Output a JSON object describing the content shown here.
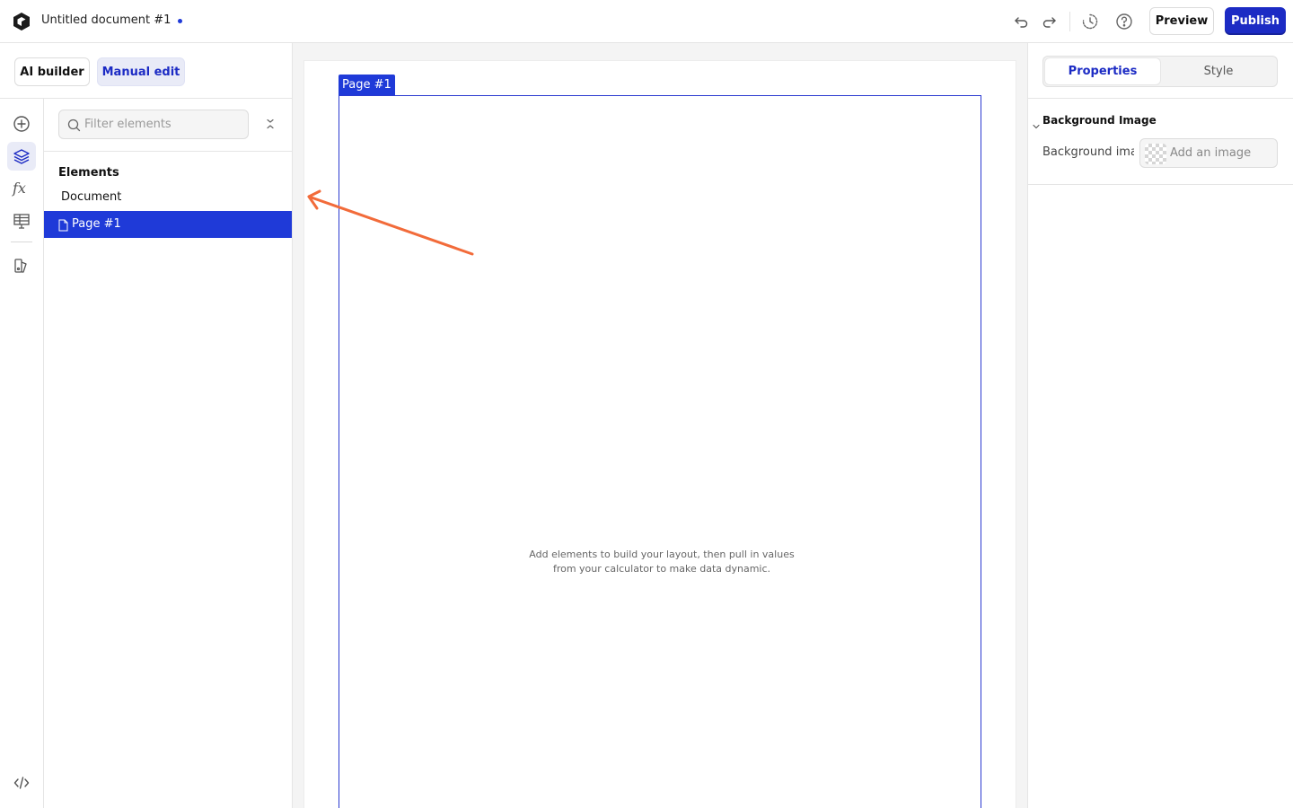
{
  "app": {
    "document_title": "Untitled document #1",
    "icons": {
      "logo": "app-logo-icon",
      "undo": "undo-icon",
      "redo": "redo-icon",
      "history": "history-icon",
      "help": "help-icon"
    }
  },
  "toolbar": {
    "preview_label": "Preview",
    "publish_label": "Publish",
    "publish_color": "#1c2bc4"
  },
  "left_panel": {
    "modes": {
      "ai_builder": "AI builder",
      "manual_edit": "Manual edit",
      "active": "manual_edit"
    },
    "rail": [
      {
        "name": "add-icon",
        "active": false
      },
      {
        "name": "layers-icon",
        "active": true
      },
      {
        "name": "formula-icon",
        "active": false
      },
      {
        "name": "table-icon",
        "active": false
      },
      {
        "name": "theme-icon",
        "active": false
      },
      {
        "name": "code-icon",
        "active": false
      }
    ],
    "filter": {
      "placeholder": "Filter elements",
      "value": ""
    },
    "tree": {
      "heading": "Elements",
      "items": [
        {
          "label": "Document",
          "selected": false
        },
        {
          "label": "Page #1",
          "selected": true
        }
      ]
    }
  },
  "canvas": {
    "page_tag": "Page #1",
    "empty_message": "Add elements to build your layout, then pull in values\nfrom your calculator to make data dynamic.",
    "accent_color": "#1f3ad8",
    "annotation_arrow_color": "#f26b3a"
  },
  "right_panel": {
    "tabs": [
      "Properties",
      "Style"
    ],
    "active_tab": "Properties",
    "section": {
      "title": "Background Image",
      "field_label": "Background image",
      "picker_text": "Add an image"
    }
  }
}
